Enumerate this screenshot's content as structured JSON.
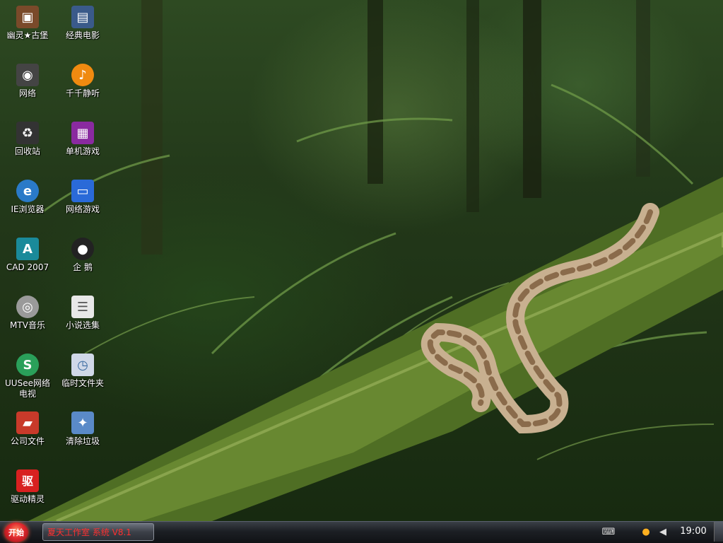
{
  "desktop": {
    "icons": [
      {
        "label": "幽灵★古堡",
        "icon": "castle-icon",
        "color": "#7a4a2a"
      },
      {
        "label": "经典电影",
        "icon": "film-icon",
        "color": "#3a5a8a"
      },
      {
        "label": "网络",
        "icon": "network-icon",
        "color": "#444444"
      },
      {
        "label": "千千静听",
        "icon": "music-player-icon",
        "color": "#f08a10"
      },
      {
        "label": "回收站",
        "icon": "recycle-bin-icon",
        "color": "#333333"
      },
      {
        "label": "单机游戏",
        "icon": "game-icon",
        "color": "#8a2aa0"
      },
      {
        "label": "IE浏览器",
        "icon": "browser-icon",
        "color": "#2a7ac8"
      },
      {
        "label": "网络游戏",
        "icon": "online-game-icon",
        "color": "#2a6ad8"
      },
      {
        "label": "CAD 2007",
        "icon": "cad-icon",
        "color": "#1a8a9a"
      },
      {
        "label": "企 鹅",
        "icon": "penguin-icon",
        "color": "#222222"
      },
      {
        "label": "MTV音乐",
        "icon": "cd-icon",
        "color": "#9a9a9a"
      },
      {
        "label": "小说选集",
        "icon": "document-icon",
        "color": "#e8e8e8"
      },
      {
        "label": "UUSee网络电视",
        "icon": "tv-icon",
        "color": "#2aa05a"
      },
      {
        "label": "临时文件夹",
        "icon": "temp-folder-icon",
        "color": "#d0d8e8"
      },
      {
        "label": "公司文件",
        "icon": "folder-icon",
        "color": "#c83a2a"
      },
      {
        "label": "清除垃圾",
        "icon": "cleaner-icon",
        "color": "#5a8ac8"
      },
      {
        "label": "驱动精灵",
        "icon": "driver-icon",
        "color": "#d82020"
      }
    ]
  },
  "taskbar": {
    "start_label": "开始",
    "task_label": "夏天工作室 系统 V8.1",
    "tray_icons": [
      "keyboard-icon",
      "qq-icon",
      "speaker-icon"
    ],
    "clock": "19:00"
  }
}
